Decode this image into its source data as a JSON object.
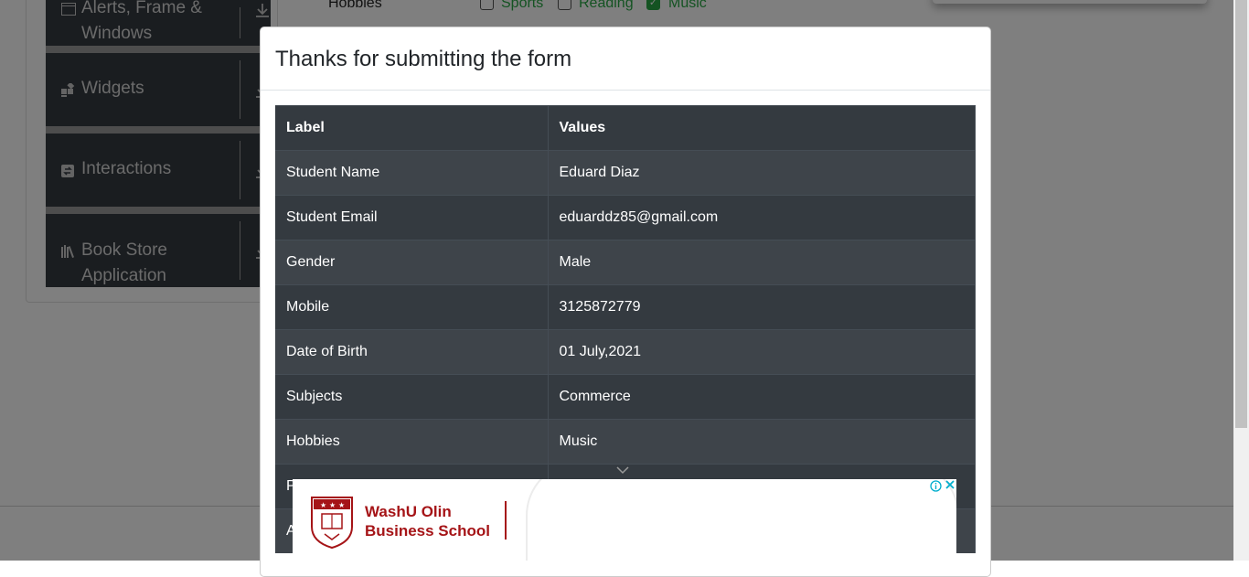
{
  "sidebar": {
    "groups": [
      {
        "label_line1": "Alerts, Frame &",
        "label_line2": "Windows",
        "icon": "window-icon"
      },
      {
        "label": "Widgets",
        "icon": "widgets-icon"
      },
      {
        "label": "Interactions",
        "icon": "interactions-icon"
      },
      {
        "label_line1": "Book Store",
        "label_line2": "Application",
        "icon": "book-icon"
      }
    ]
  },
  "form": {
    "hobbies_label": "Hobbies",
    "hobbies": [
      {
        "label": "Sports",
        "checked": false
      },
      {
        "label": "Reading",
        "checked": false
      },
      {
        "label": "Music",
        "checked": true
      }
    ]
  },
  "modal": {
    "title": "Thanks for submitting the form",
    "table": {
      "headers": [
        "Label",
        "Values"
      ],
      "rows": [
        {
          "label": "Student Name",
          "value": "Eduard Diaz"
        },
        {
          "label": "Student Email",
          "value": "eduarddz85@gmail.com"
        },
        {
          "label": "Gender",
          "value": "Male"
        },
        {
          "label": "Mobile",
          "value": "3125872779"
        },
        {
          "label": "Date of Birth",
          "value": "01 July,2021"
        },
        {
          "label": "Subjects",
          "value": "Commerce"
        },
        {
          "label": "Hobbies",
          "value": "Music"
        },
        {
          "label": "P",
          "value": ""
        },
        {
          "label": "A",
          "value": ""
        }
      ]
    }
  },
  "ad": {
    "school_line1": "WashU Olin",
    "school_line2": "Business School",
    "info_icon": "info-icon",
    "close_icon": "close-icon"
  },
  "colors": {
    "sidebar_bg": "#353a40",
    "table_bg": "#343a40",
    "checkbox_green": "#28a745",
    "ad_red": "#a51417",
    "ad_blue": "#00aecd"
  }
}
